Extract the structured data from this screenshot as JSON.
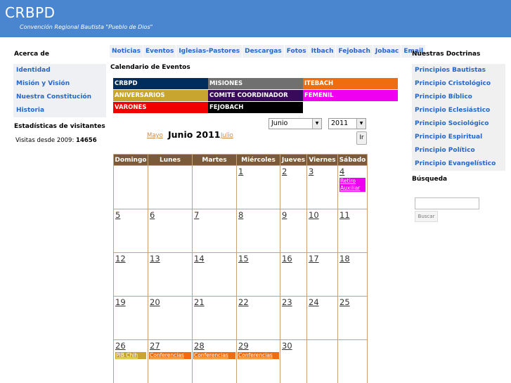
{
  "header": {
    "title": "CRBPD",
    "subtitle": "Convención Regional Bautista \"Pueblo de Dios\""
  },
  "left_sidebar": {
    "heading": "Acerca de",
    "items": [
      "Identidad",
      "Misión y Visión",
      "Nuestra Constitución",
      "Historia"
    ],
    "stats_heading": "Estadísticas de visitantes",
    "stats_label": "Visitas desde 2009:",
    "stats_value": "14656"
  },
  "top_nav": [
    "Noticias",
    "Eventos",
    "Iglesias-Pastores",
    "Descargas",
    "Fotos",
    "Itbach",
    "Fejobach",
    "Jobaac",
    "Email"
  ],
  "calendar": {
    "heading": "Calendario de Eventos",
    "legend": [
      {
        "label": "CRBPD",
        "color": "#002d5c"
      },
      {
        "label": "MISIONES",
        "color": "#707070"
      },
      {
        "label": "ITEBACH",
        "color": "#f06d0f"
      },
      {
        "label": "ANIVERSARIOS",
        "color": "#c8a52e"
      },
      {
        "label": "COMITE COORDINADOR",
        "color": "#3a0a5a"
      },
      {
        "label": "FEMENIL",
        "color": "#f000f0"
      },
      {
        "label": "VARONES",
        "color": "#f00000"
      },
      {
        "label": "FEJOBACH",
        "color": "#000000"
      }
    ],
    "prev_month": "Mayo",
    "current_month": "Junio 2011",
    "next_month": "Julio",
    "month_select": "Junio",
    "year_select": "2011",
    "go_button": "Ir",
    "weekdays": [
      "Domingo",
      "Lunes",
      "Martes",
      "Miércoles",
      "Jueves",
      "Viernes",
      "Sábado"
    ],
    "weeks": [
      [
        "",
        "",
        "",
        "1",
        "2",
        "3",
        "4"
      ],
      [
        "5",
        "6",
        "7",
        "8",
        "9",
        "10",
        "11"
      ],
      [
        "12",
        "13",
        "14",
        "15",
        "16",
        "17",
        "18"
      ],
      [
        "19",
        "20",
        "21",
        "22",
        "23",
        "24",
        "25"
      ],
      [
        "26",
        "27",
        "28",
        "29",
        "30",
        "",
        ""
      ]
    ],
    "events": {
      "sat_4": "Retiro Auxiliar",
      "sun_26": "PIB Chih",
      "mon_27": "Conferencias",
      "tue_28": "Conferencias",
      "wed_29": "Conferencias"
    }
  },
  "right_sidebar": {
    "heading": "Nuestras Doctrinas",
    "items": [
      "Principios Bautistas",
      "Principio Cristológico",
      "Principio Bíblico",
      "Principio Eclesiástico",
      "Principio Sociológico",
      "Principio Espiritual",
      "Principio Político",
      "Principio Evangelístico"
    ],
    "search_heading": "Búsqueda",
    "search_value": "",
    "search_button": "Buscar"
  }
}
